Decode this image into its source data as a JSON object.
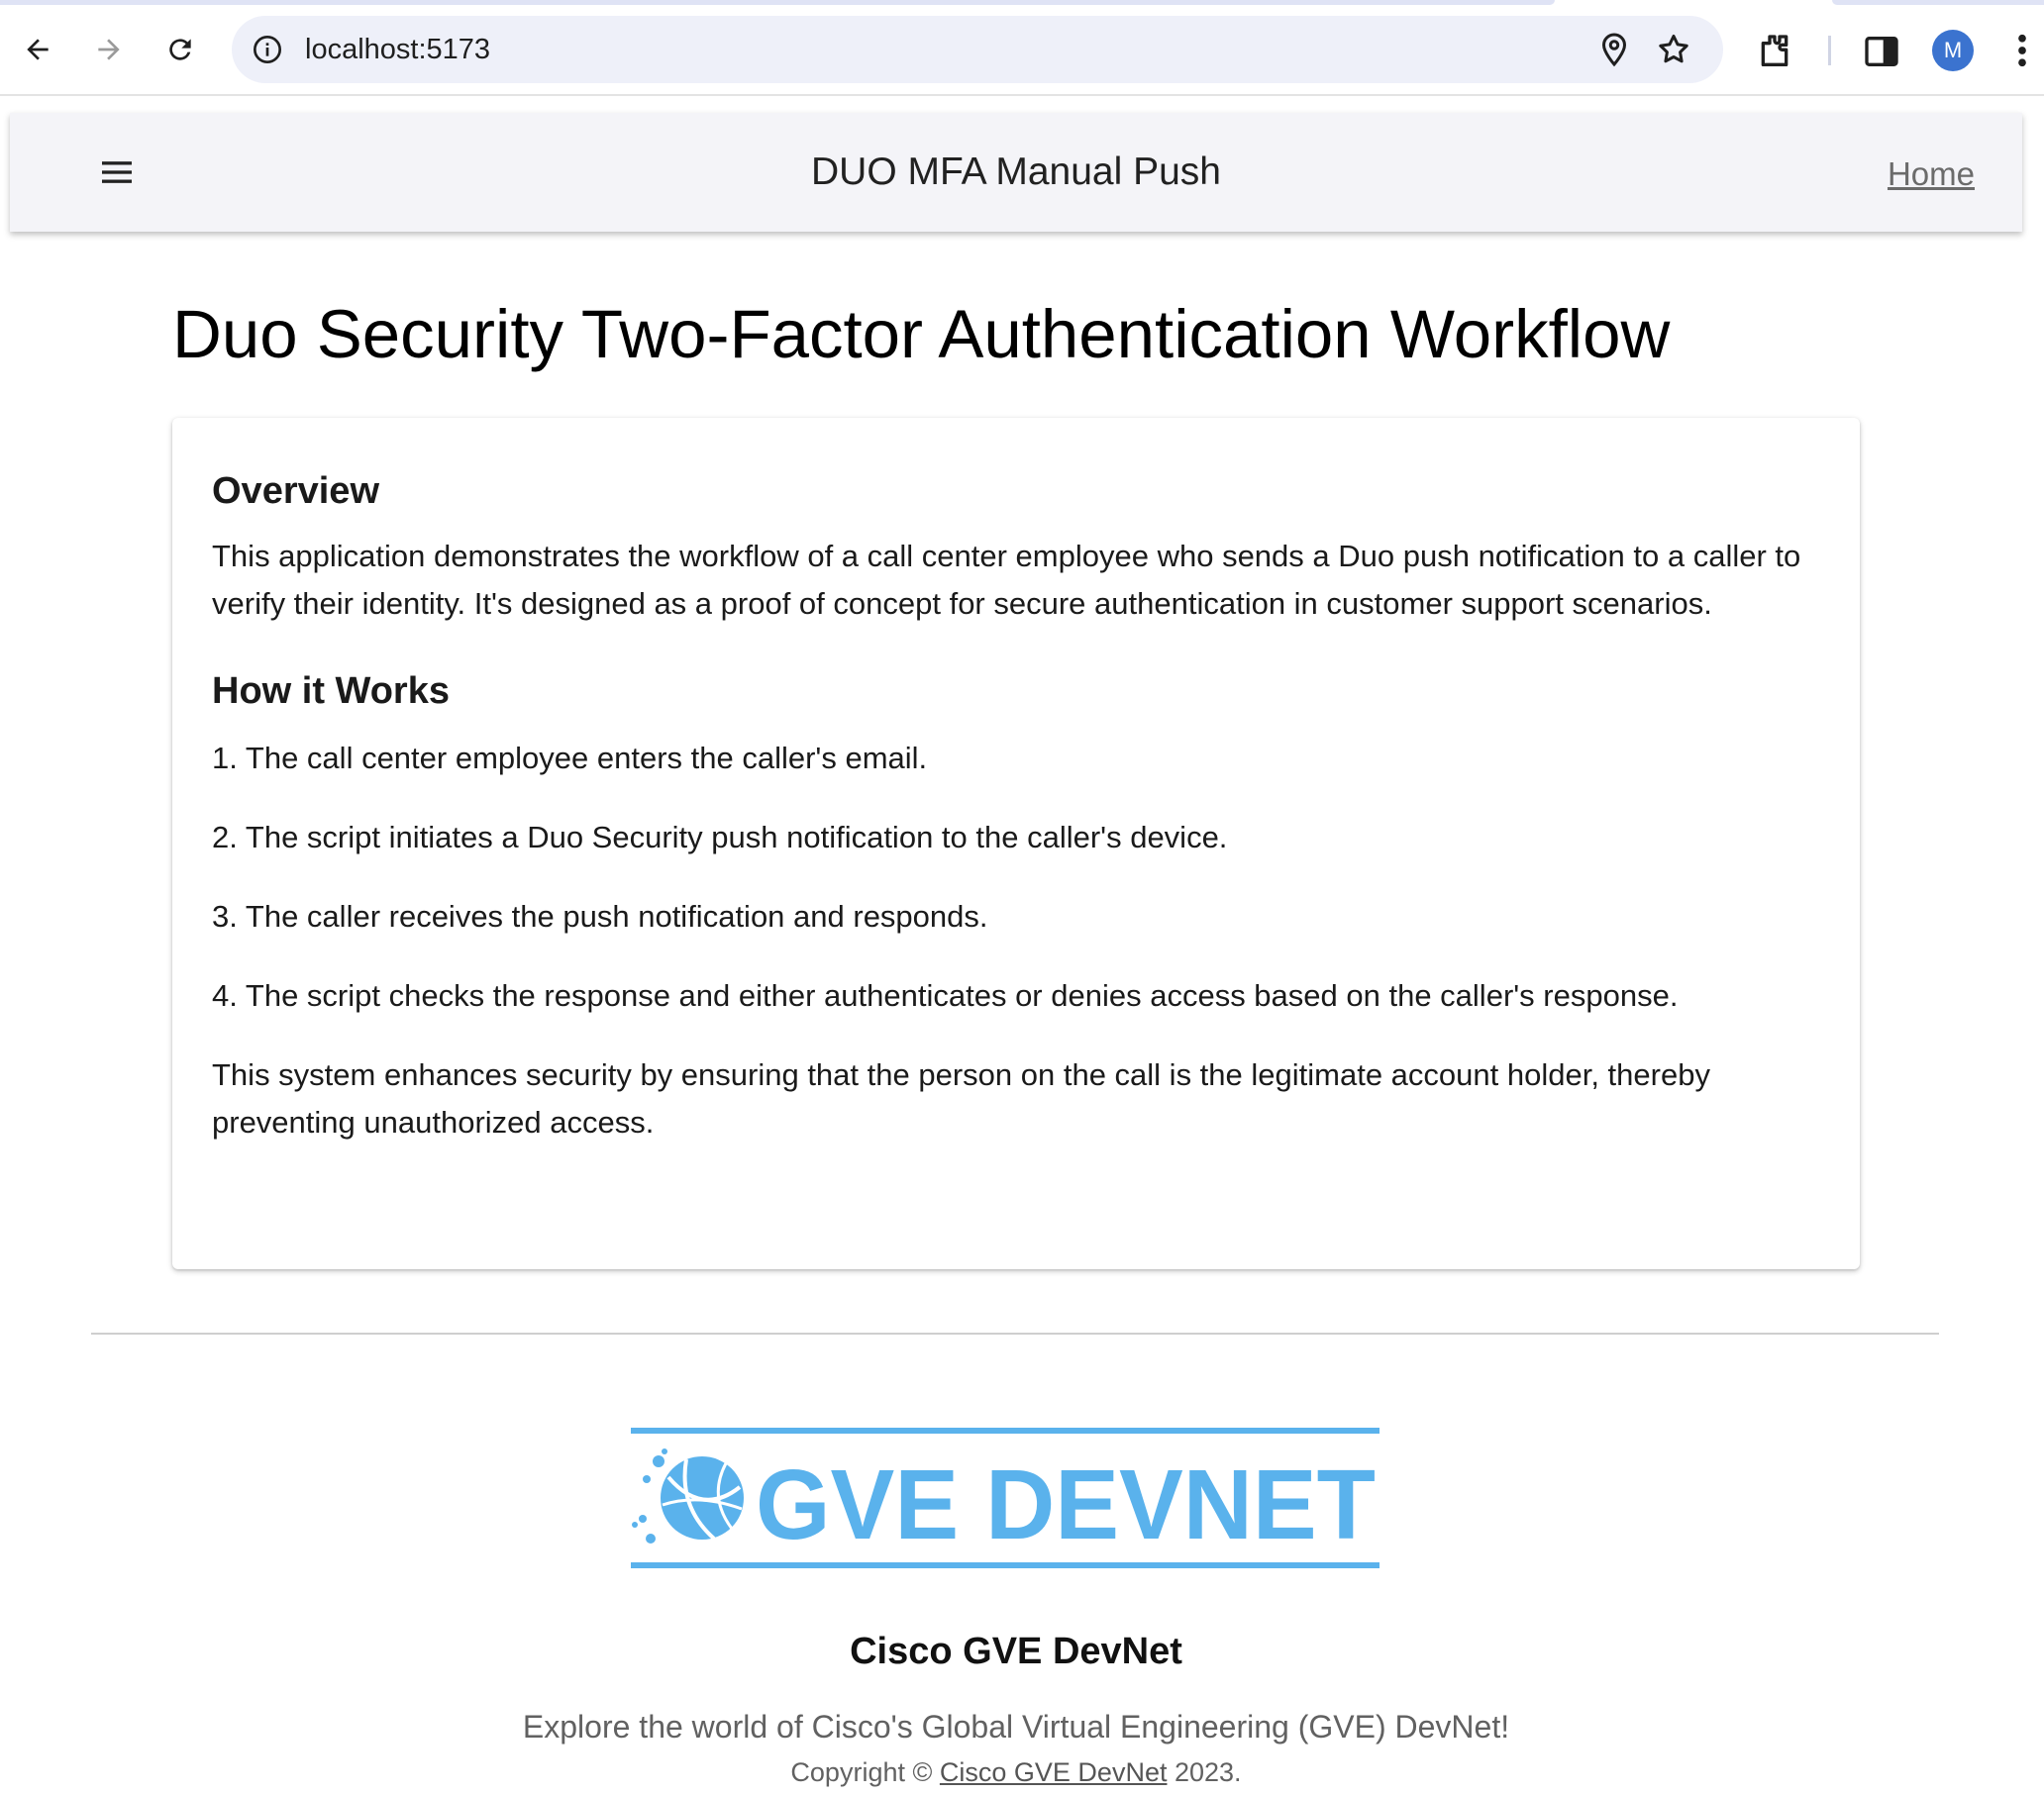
{
  "browser": {
    "url": "localhost:5173",
    "avatar_initial": "M",
    "icons": [
      "back-icon",
      "forward-icon",
      "reload-icon",
      "site-info-icon",
      "location-icon",
      "bookmark-star-icon",
      "extensions-icon",
      "side-panel-icon",
      "more-menu-icon"
    ]
  },
  "app_bar": {
    "title": "DUO MFA Manual Push",
    "home_label": "Home"
  },
  "main": {
    "heading": "Duo Security Two-Factor Authentication Workflow",
    "overview_title": "Overview",
    "overview_text": "This application demonstrates the workflow of a call center employee who sends a Duo push notification to a caller to verify their identity. It's designed as a proof of concept for secure authentication in customer support scenarios.",
    "how_title": "How it Works",
    "steps": [
      "1. The call center employee enters the caller's email.",
      "2. The script initiates a Duo Security push notification to the caller's device.",
      "3. The caller receives the push notification and responds.",
      "4. The script checks the response and either authenticates or denies access based on the caller's response."
    ],
    "closing_text": "This system enhances security by ensuring that the person on the call is the legitimate account holder, thereby preventing unauthorized access."
  },
  "footer": {
    "logo_text": "GVE DEVNET",
    "name": "Cisco GVE DevNet",
    "tagline": "Explore the world of Cisco's Global Virtual Engineering (GVE) DevNet!",
    "copyright_prefix": "Copyright ©",
    "copyright_link": "Cisco GVE DevNet",
    "copyright_suffix": "2023."
  },
  "colors": {
    "logo_blue": "#5ab2ec",
    "app_bar_bg": "#f4f4f8",
    "avatar_blue": "#3b73cf"
  }
}
